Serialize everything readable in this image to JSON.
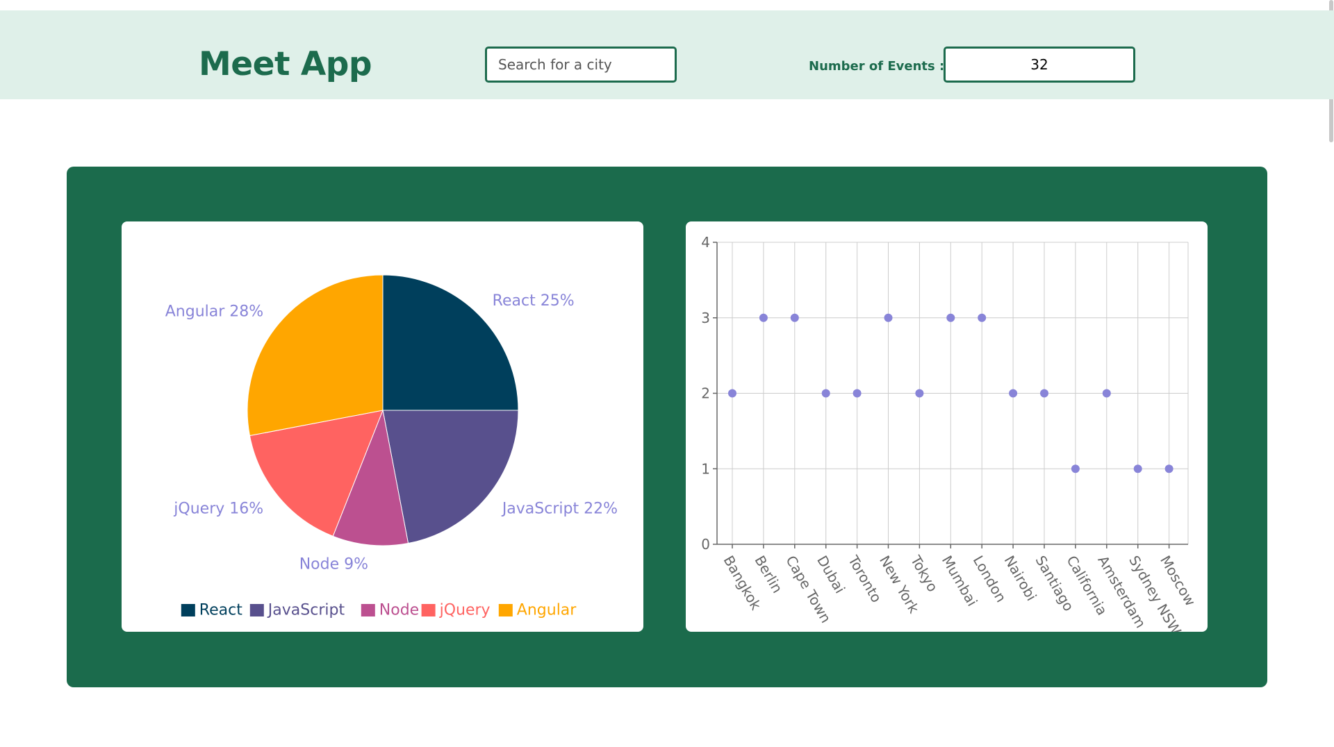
{
  "app": {
    "title": "Meet App"
  },
  "search": {
    "placeholder": "Search for a city",
    "value": ""
  },
  "events": {
    "label": "Number of Events :",
    "value": "32"
  },
  "colors": {
    "brand": "#1c6b4d",
    "header_bg": "#dff0e9",
    "panel_bg": "#1b6b4c",
    "scatter_point": "#8884d8",
    "pie_label": "#8884d8"
  },
  "chart_data": [
    {
      "type": "pie",
      "slices": [
        {
          "name": "React",
          "value": 25,
          "label": "React 25%",
          "color": "#003f5c"
        },
        {
          "name": "JavaScript",
          "value": 22,
          "label": "JavaScript 22%",
          "color": "#58508d"
        },
        {
          "name": "Node",
          "value": 9,
          "label": "Node 9%",
          "color": "#bc5090"
        },
        {
          "name": "jQuery",
          "value": 16,
          "label": "jQuery 16%",
          "color": "#ff6361"
        },
        {
          "name": "Angular",
          "value": 28,
          "label": "Angular 28%",
          "color": "#ffa600"
        }
      ],
      "legend": [
        "React",
        "JavaScript",
        "Node",
        "jQuery",
        "Angular"
      ],
      "legend_position": "bottom"
    },
    {
      "type": "scatter",
      "categories": [
        "Bangkok",
        "Berlin",
        "Cape Town",
        "Dubai",
        "Toronto",
        "New York",
        "Tokyo",
        "Mumbai",
        "London",
        "Nairobi",
        "Santiago",
        "California",
        "Amsterdam",
        "Sydney NSW",
        "Moscow"
      ],
      "values": [
        2,
        3,
        3,
        2,
        2,
        3,
        2,
        3,
        3,
        2,
        2,
        1,
        2,
        1,
        1
      ],
      "ylim": [
        0,
        4
      ],
      "yticks": [
        "0",
        "1",
        "2",
        "3",
        "4"
      ],
      "grid": true,
      "xlabel": "",
      "ylabel": ""
    }
  ]
}
